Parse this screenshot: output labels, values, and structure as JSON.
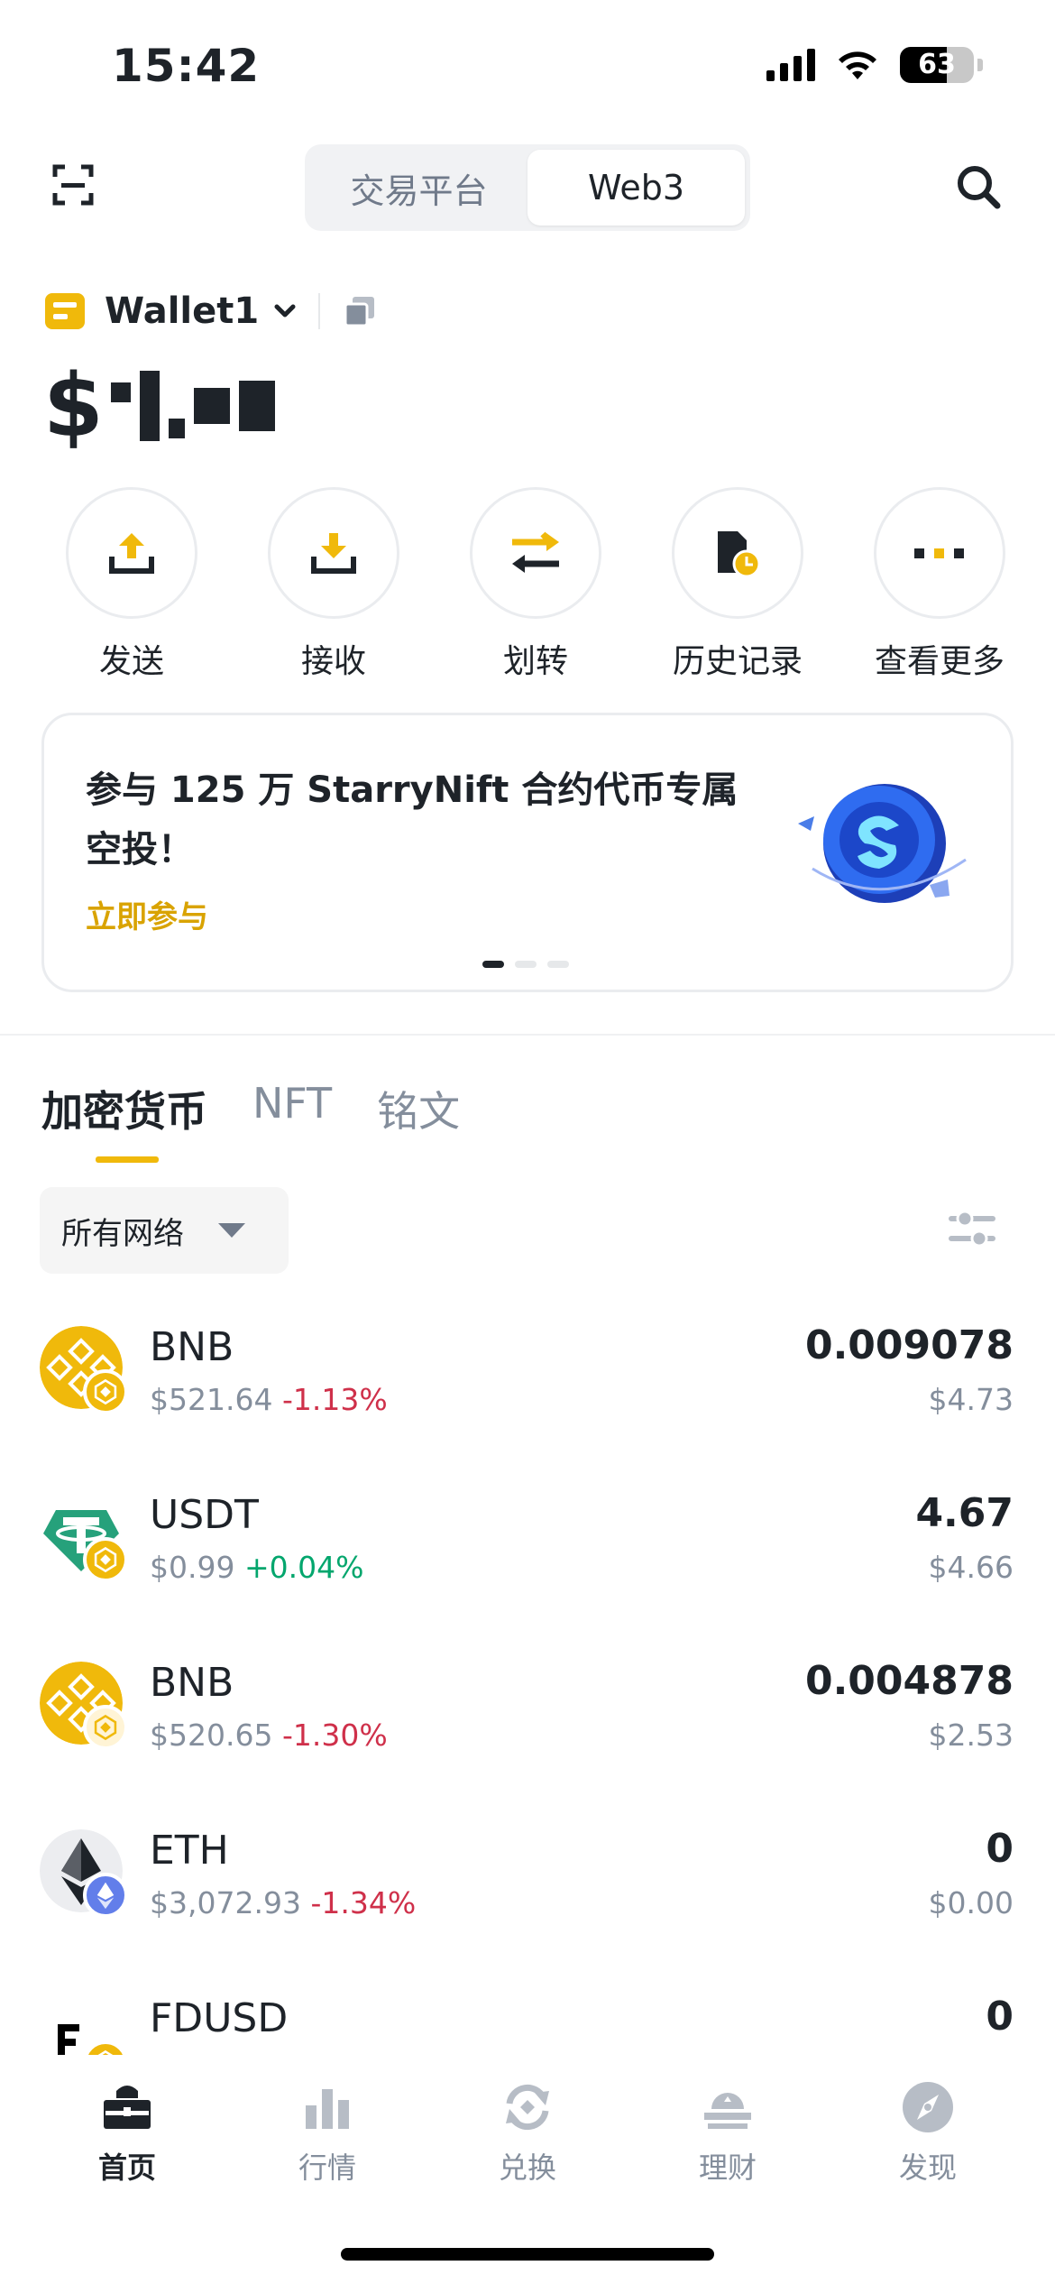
{
  "status": {
    "time": "15:42",
    "battery": "63",
    "battery_level": 0.63
  },
  "header": {
    "segments": [
      "交易平台",
      "Web3"
    ],
    "active_segment": 1
  },
  "wallet": {
    "name": "Wallet1",
    "balance_prefix": "$"
  },
  "actions": [
    {
      "label": "发送",
      "icon": "send-upload-icon"
    },
    {
      "label": "接收",
      "icon": "receive-download-icon"
    },
    {
      "label": "划转",
      "icon": "transfer-arrows-icon"
    },
    {
      "label": "历史记录",
      "icon": "history-document-clock-icon"
    },
    {
      "label": "查看更多",
      "icon": "more-dots-icon"
    }
  ],
  "banner": {
    "title": "参与 125 万 StarryNift 合约代币专属空投！",
    "link": "立即参与"
  },
  "tabs": [
    "加密货币",
    "NFT",
    "铭文"
  ],
  "network_filter": {
    "label": "所有网络"
  },
  "assets": [
    {
      "name": "BNB",
      "price": "$521.64",
      "change": "-1.13%",
      "amount": "0.009078",
      "value": "$4.73",
      "icon": "bnb-icon",
      "chain": "bsc-chain-icon",
      "color": "#f0b90b"
    },
    {
      "name": "USDT",
      "price": "$0.99",
      "change": "+0.04%",
      "amount": "4.67",
      "value": "$4.66",
      "icon": "usdt-icon",
      "chain": "bsc-chain-icon",
      "color": "#26a17b"
    },
    {
      "name": "BNB",
      "price": "$520.65",
      "change": "-1.30%",
      "amount": "0.004878",
      "value": "$2.53",
      "icon": "bnb-icon",
      "chain": "opbnb-chain-icon",
      "color": "#f0b90b"
    },
    {
      "name": "ETH",
      "price": "$3,072.93",
      "change": "-1.34%",
      "amount": "0",
      "value": "$0.00",
      "icon": "eth-icon",
      "chain": "ethereum-chain-icon",
      "color": "#627eea"
    },
    {
      "name": "FDUSD",
      "price": "",
      "change": "",
      "amount": "0",
      "value": "",
      "icon": "fdusd-icon",
      "chain": "bsc-chain-icon",
      "color": "#000000"
    }
  ],
  "bottom_nav": [
    {
      "label": "首页",
      "icon": "home-icon",
      "active": true
    },
    {
      "label": "行情",
      "icon": "markets-bar-chart-icon",
      "active": false
    },
    {
      "label": "兑换",
      "icon": "swap-icon",
      "active": false
    },
    {
      "label": "理财",
      "icon": "earn-icon",
      "active": false
    },
    {
      "label": "发现",
      "icon": "discover-compass-icon",
      "active": false
    }
  ],
  "colors": {
    "brand_yellow": "#f0b90b",
    "text_primary": "#1e2329",
    "text_secondary": "#848e9c",
    "negative": "#cf304a",
    "positive": "#03a66d"
  }
}
